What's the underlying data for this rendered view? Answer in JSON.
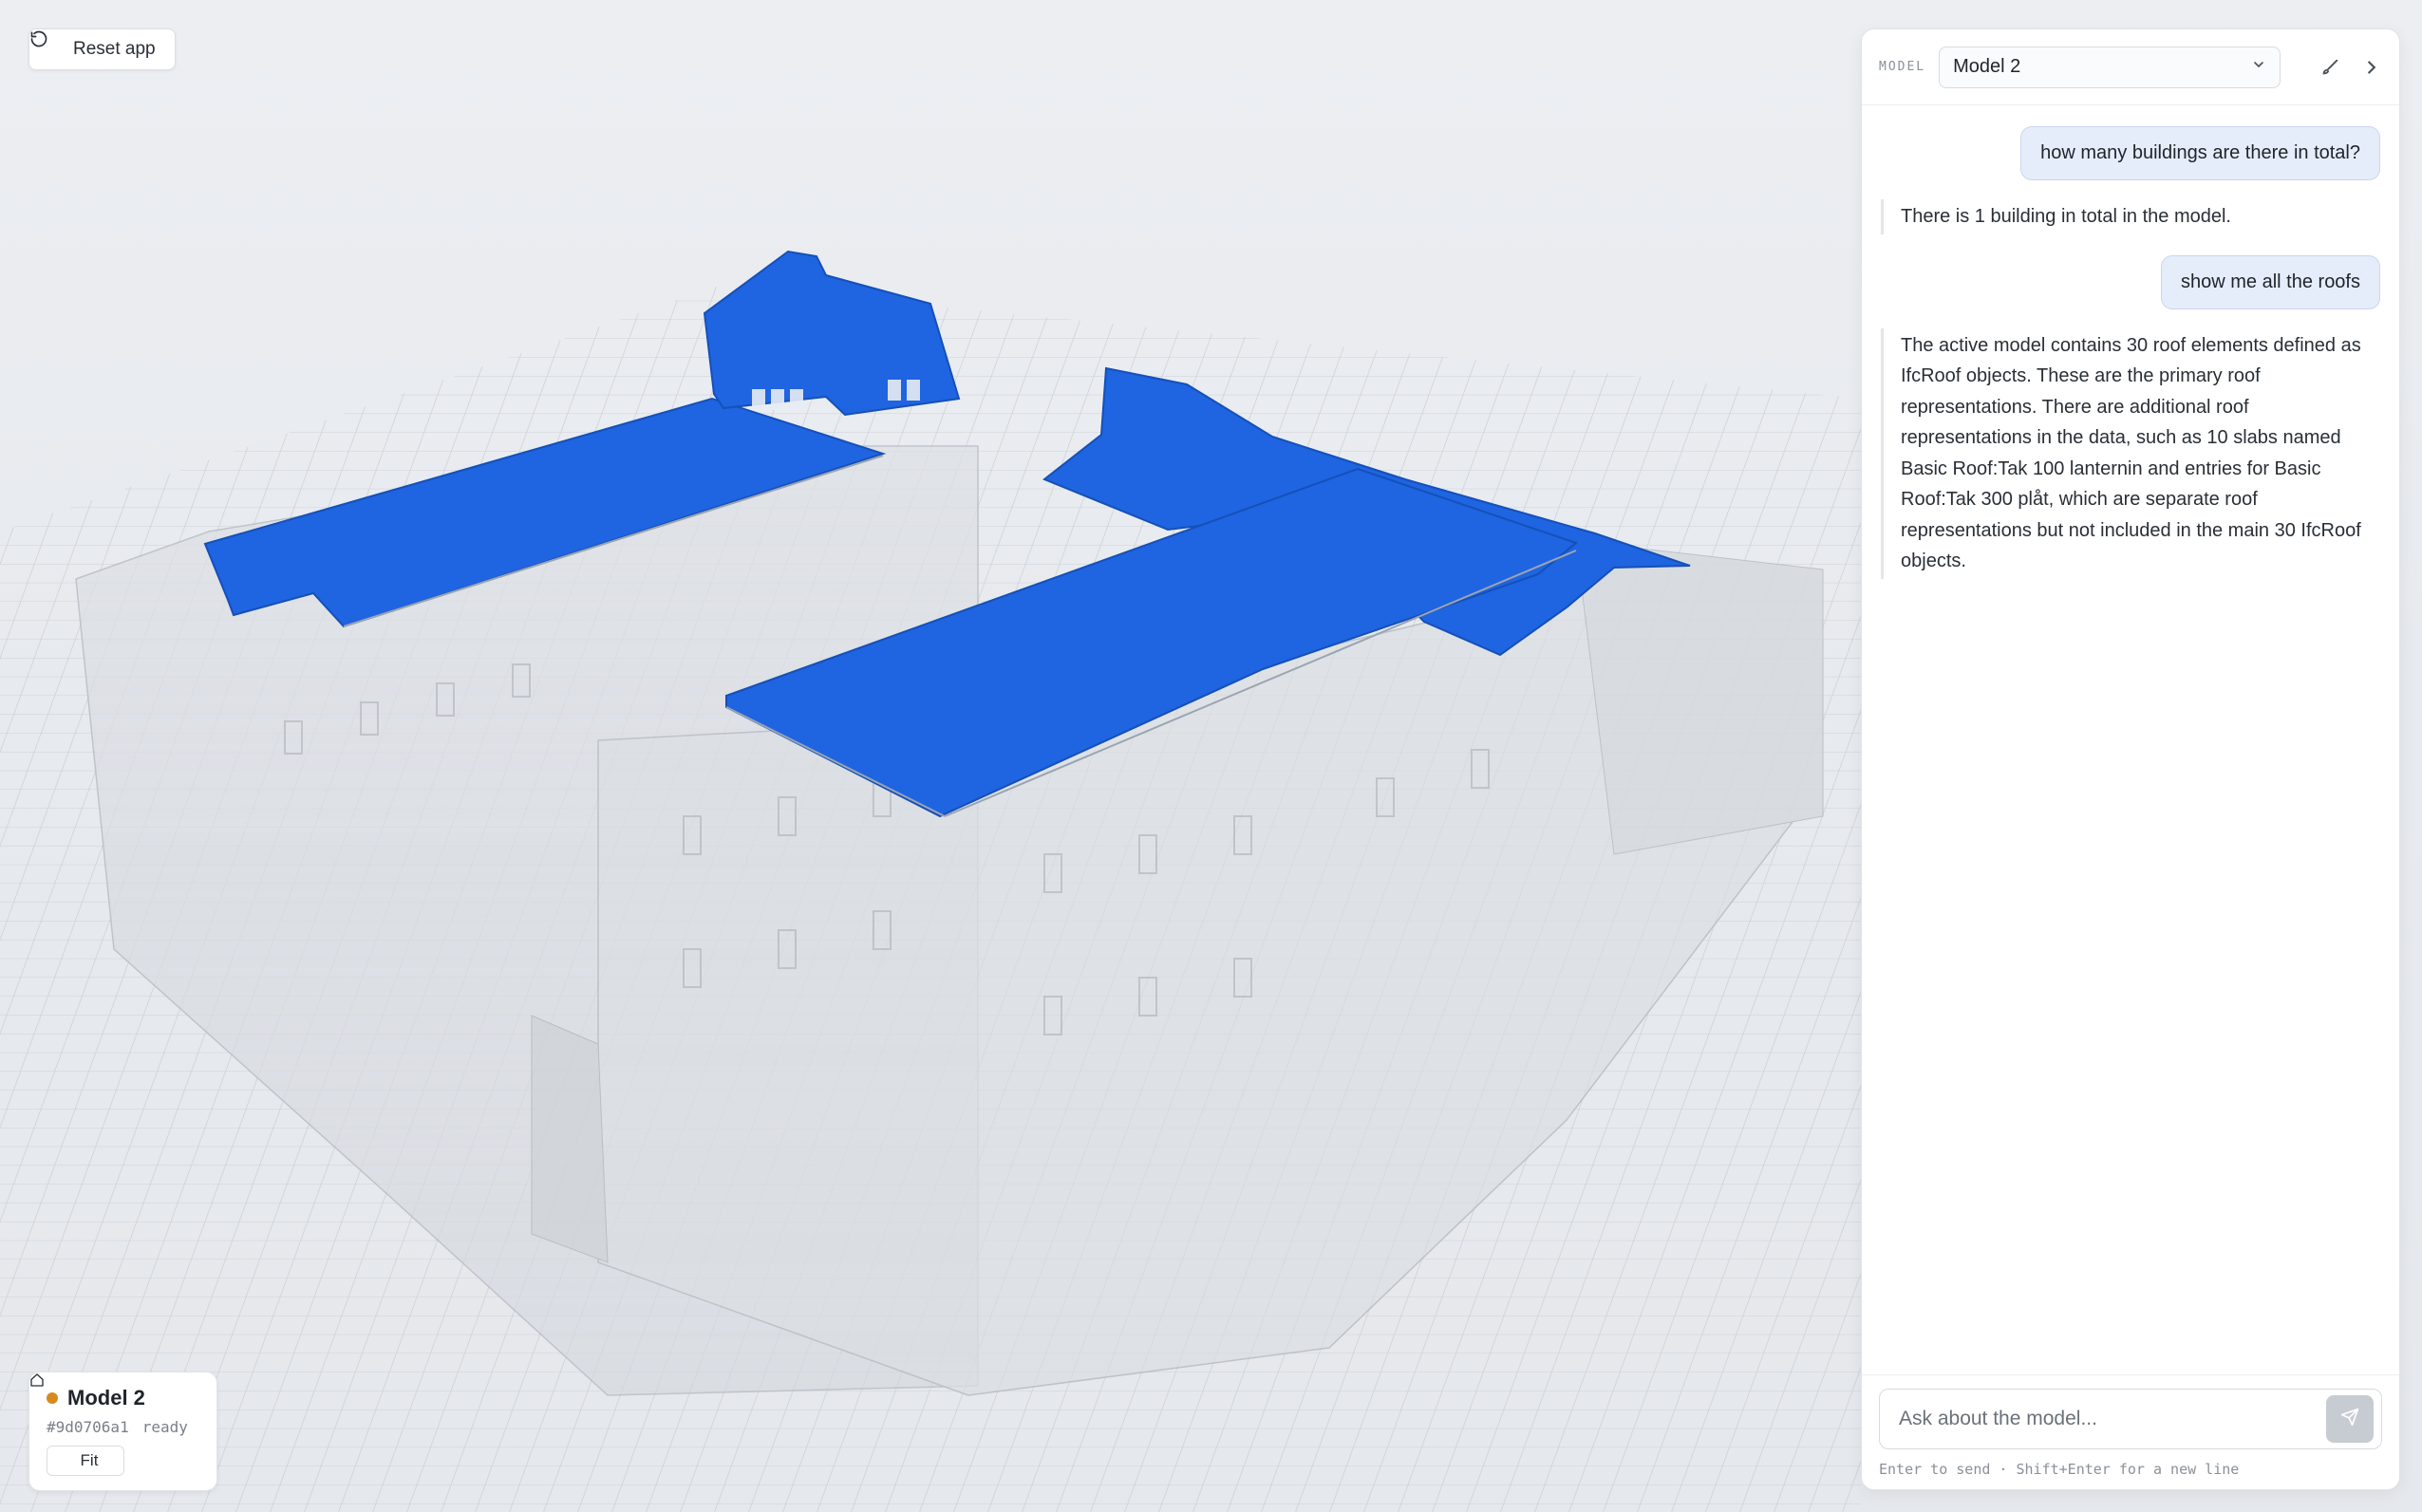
{
  "toolbar": {
    "reset_label": "Reset app"
  },
  "model_card": {
    "name": "Model 2",
    "id": "#9d0706a1",
    "status": "ready",
    "fit_label": "Fit",
    "status_color": "#d68a1e"
  },
  "chat": {
    "model_label": "MODEL",
    "selected_model": "Model 2",
    "messages": [
      {
        "role": "user",
        "text": "how many buildings are there in total?"
      },
      {
        "role": "assistant",
        "text": "There is 1 building in total in the model."
      },
      {
        "role": "user",
        "text": "show me all the roofs"
      },
      {
        "role": "assistant",
        "text": "The active model contains 30 roof elements defined as IfcRoof objects. These are the primary roof representations. There are additional roof representations in the data, such as 10 slabs named Basic Roof:Tak 100 lanternin and entries for Basic Roof:Tak 300 plåt, which are separate roof representations but not included in the main 30 IfcRoof objects."
      }
    ],
    "input_placeholder": "Ask about the model...",
    "hint": "Enter to send · Shift+Enter for a new line"
  },
  "colors": {
    "highlight": "#1f64e0",
    "building": "#dfe2e7",
    "background": "#e8ebef"
  },
  "icons": {
    "reset": "rotate-ccw-icon",
    "home": "home-icon",
    "chevron": "chevron-down-icon",
    "brush": "brush-icon",
    "collapse": "chevron-right-icon",
    "send": "send-icon"
  }
}
